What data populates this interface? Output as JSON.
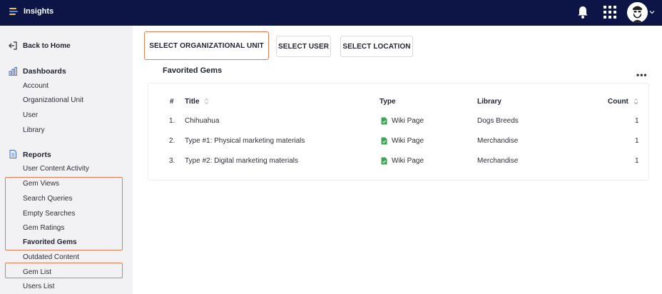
{
  "app": {
    "title": "Insights"
  },
  "sidebar": {
    "back": "Back to Home",
    "dashboards": {
      "heading": "Dashboards",
      "items": [
        "Account",
        "Organizational Unit",
        "User",
        "Library"
      ]
    },
    "reports": {
      "heading": "Reports",
      "items": [
        "User Content Activity",
        "Gem Views",
        "Search Queries",
        "Empty Searches",
        "Gem Ratings",
        "Favorited Gems",
        "Outdated Content",
        "Gem List",
        "Users List"
      ],
      "active": "Favorited Gems"
    }
  },
  "toolbar": {
    "select_org_unit": "SELECT ORGANIZATIONAL UNIT",
    "select_user": "SELECT USER",
    "select_location": "SELECT LOCATION"
  },
  "section": {
    "title": "Favorited Gems",
    "menu": "•••"
  },
  "table": {
    "headers": {
      "index": "#",
      "title": "Title",
      "type": "Type",
      "library": "Library",
      "count": "Count"
    },
    "rows": [
      {
        "index": "1.",
        "title": "Chihuahua",
        "type": "Wiki Page",
        "library": "Dogs Breeds",
        "count": "1"
      },
      {
        "index": "2.",
        "title": "Type #1: Physical marketing materials",
        "type": "Wiki Page",
        "library": "Merchandise",
        "count": "1"
      },
      {
        "index": "3.",
        "title": "Type #2: Digital marketing materials",
        "type": "Wiki Page",
        "library": "Merchandise",
        "count": "1"
      }
    ]
  },
  "colors": {
    "topbar": "#0d1546",
    "highlight": "#e07b53",
    "sidebar_bg": "#f2f2f4",
    "doc_icon": "#3aa757"
  },
  "icons": [
    "menu-logo-icon",
    "bell-icon",
    "apps-grid-icon",
    "user-avatar",
    "chevron-down-icon",
    "back-arrow-icon",
    "bar-chart-icon",
    "document-icon",
    "sort-icon",
    "kebab-menu-icon"
  ]
}
